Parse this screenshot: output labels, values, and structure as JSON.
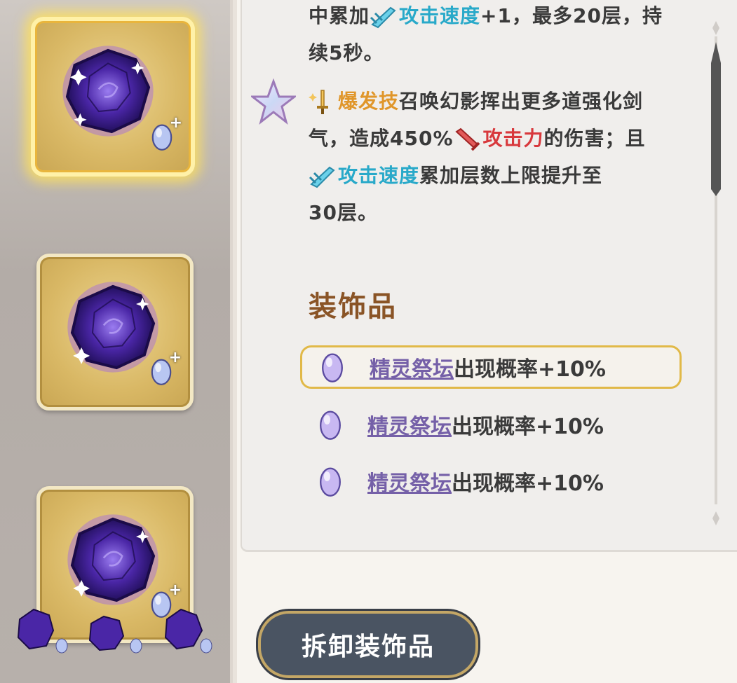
{
  "description": {
    "line1_prefix": "中累加",
    "attack_speed": "攻击速度",
    "line1_suffix": "+1，最多20层，持",
    "line2": "续5秒。",
    "burst_skill": "爆发技",
    "burst_text_1": "召唤幻影挥出更多道强化剑",
    "burst_text_2a": "气，造成450%",
    "attack_power": "攻击力",
    "burst_text_2b": "的伤害；且",
    "attack_speed_2": "攻击速度",
    "burst_text_3": "累加层数上限提升至",
    "burst_text_4": "30层。"
  },
  "mods": {
    "title": "装饰品",
    "items": [
      {
        "link": "精灵祭坛",
        "text": "出现概率+10%"
      },
      {
        "link": "精灵祭坛",
        "text": "出现概率+10%"
      },
      {
        "link": "精灵祭坛",
        "text": "出现概率+10%"
      }
    ]
  },
  "button": {
    "remove_label": "拆卸装饰品"
  },
  "colors": {
    "keyword_blue": "#29a9c9",
    "keyword_orange": "#e0962a",
    "keyword_red": "#d8383c",
    "link_purple": "#7560a8",
    "button_bg": "#4a5462"
  },
  "icons": [
    "gem-icon",
    "egg-icon",
    "sword-icon",
    "star-icon",
    "scroll-icon"
  ]
}
